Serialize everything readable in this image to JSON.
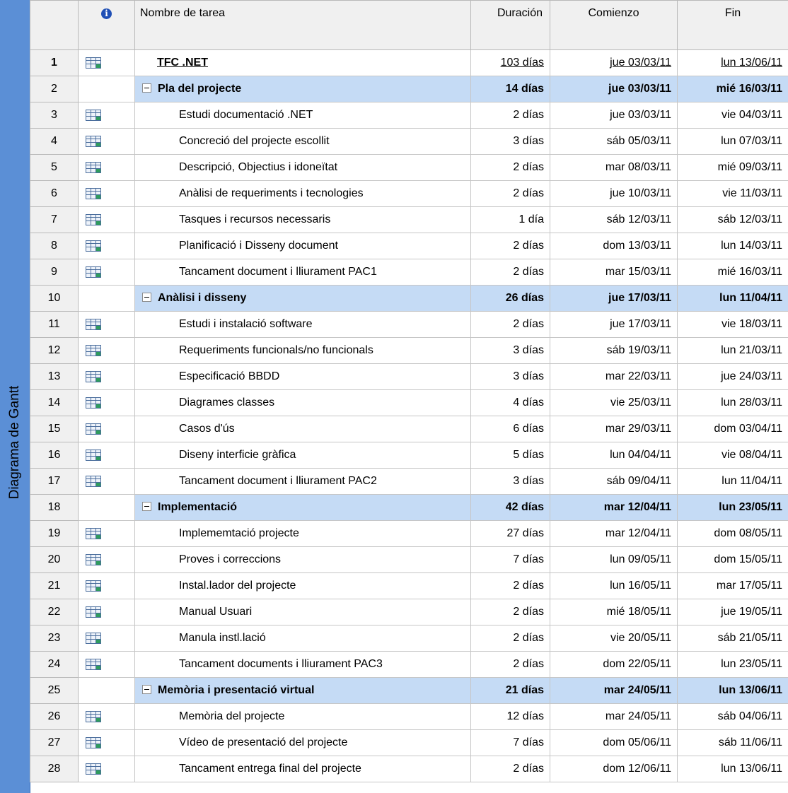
{
  "sidebar": {
    "label": "Diagrama de Gantt"
  },
  "header": {
    "indicator_icon": "info-icon",
    "name": "Nombre de tarea",
    "duration": "Duración",
    "start": "Comienzo",
    "finish": "Fin"
  },
  "tasks": [
    {
      "id": "1",
      "name": "TFC .NET",
      "duration": "103 días",
      "start": "jue 03/03/11",
      "finish": "lun 13/06/11",
      "type": "project",
      "icon": "task-icon"
    },
    {
      "id": "2",
      "name": "Pla del projecte",
      "duration": "14 días",
      "start": "jue 03/03/11",
      "finish": "mié 16/03/11",
      "type": "summary",
      "icon": ""
    },
    {
      "id": "3",
      "name": "Estudi documentació .NET",
      "duration": "2 días",
      "start": "jue 03/03/11",
      "finish": "vie 04/03/11",
      "type": "task",
      "icon": "task-icon"
    },
    {
      "id": "4",
      "name": "Concreció del projecte escollit",
      "duration": "3 días",
      "start": "sáb 05/03/11",
      "finish": "lun 07/03/11",
      "type": "task",
      "icon": "task-icon"
    },
    {
      "id": "5",
      "name": "Descripció, Objectius i idoneïtat",
      "duration": "2 días",
      "start": "mar 08/03/11",
      "finish": "mié 09/03/11",
      "type": "task",
      "icon": "task-icon"
    },
    {
      "id": "6",
      "name": "Anàlisi de requeriments i tecnologies",
      "duration": "2 días",
      "start": "jue 10/03/11",
      "finish": "vie 11/03/11",
      "type": "task",
      "icon": "task-icon"
    },
    {
      "id": "7",
      "name": "Tasques i recursos necessaris",
      "duration": "1 día",
      "start": "sáb 12/03/11",
      "finish": "sáb 12/03/11",
      "type": "task",
      "icon": "task-icon"
    },
    {
      "id": "8",
      "name": "Planificació i Disseny document",
      "duration": "2 días",
      "start": "dom 13/03/11",
      "finish": "lun 14/03/11",
      "type": "task",
      "icon": "task-icon"
    },
    {
      "id": "9",
      "name": "Tancament document i lliurament PAC1",
      "duration": "2 días",
      "start": "mar 15/03/11",
      "finish": "mié 16/03/11",
      "type": "task",
      "icon": "task-icon"
    },
    {
      "id": "10",
      "name": "Anàlisi i disseny",
      "duration": "26 días",
      "start": "jue 17/03/11",
      "finish": "lun 11/04/11",
      "type": "summary",
      "icon": ""
    },
    {
      "id": "11",
      "name": "Estudi i instalació software",
      "duration": "2 días",
      "start": "jue 17/03/11",
      "finish": "vie 18/03/11",
      "type": "task",
      "icon": "task-icon"
    },
    {
      "id": "12",
      "name": "Requeriments funcionals/no funcionals",
      "duration": "3 días",
      "start": "sáb 19/03/11",
      "finish": "lun 21/03/11",
      "type": "task",
      "icon": "task-icon"
    },
    {
      "id": "13",
      "name": "Especificació BBDD",
      "duration": "3 días",
      "start": "mar 22/03/11",
      "finish": "jue 24/03/11",
      "type": "task",
      "icon": "task-icon"
    },
    {
      "id": "14",
      "name": "Diagrames classes",
      "duration": "4 días",
      "start": "vie 25/03/11",
      "finish": "lun 28/03/11",
      "type": "task",
      "icon": "task-icon"
    },
    {
      "id": "15",
      "name": "Casos d'ús",
      "duration": "6 días",
      "start": "mar 29/03/11",
      "finish": "dom 03/04/11",
      "type": "task",
      "icon": "task-icon"
    },
    {
      "id": "16",
      "name": "Diseny interficie gràfica",
      "duration": "5 días",
      "start": "lun 04/04/11",
      "finish": "vie 08/04/11",
      "type": "task",
      "icon": "task-icon"
    },
    {
      "id": "17",
      "name": "Tancament document i lliurament PAC2",
      "duration": "3 días",
      "start": "sáb 09/04/11",
      "finish": "lun 11/04/11",
      "type": "task",
      "icon": "task-icon"
    },
    {
      "id": "18",
      "name": "Implementació",
      "duration": "42 días",
      "start": "mar 12/04/11",
      "finish": "lun 23/05/11",
      "type": "summary",
      "icon": ""
    },
    {
      "id": "19",
      "name": "Implememtació projecte",
      "duration": "27 días",
      "start": "mar 12/04/11",
      "finish": "dom 08/05/11",
      "type": "task",
      "icon": "task-icon"
    },
    {
      "id": "20",
      "name": "Proves i correccions",
      "duration": "7 días",
      "start": "lun 09/05/11",
      "finish": "dom 15/05/11",
      "type": "task",
      "icon": "task-icon"
    },
    {
      "id": "21",
      "name": "Instal.lador del projecte",
      "duration": "2 días",
      "start": "lun 16/05/11",
      "finish": "mar 17/05/11",
      "type": "task",
      "icon": "task-icon"
    },
    {
      "id": "22",
      "name": "Manual Usuari",
      "duration": "2 días",
      "start": "mié 18/05/11",
      "finish": "jue 19/05/11",
      "type": "task",
      "icon": "task-icon"
    },
    {
      "id": "23",
      "name": "Manula instl.lació",
      "duration": "2 días",
      "start": "vie 20/05/11",
      "finish": "sáb 21/05/11",
      "type": "task",
      "icon": "task-icon"
    },
    {
      "id": "24",
      "name": "Tancament documents i lliurament PAC3",
      "duration": "2 días",
      "start": "dom 22/05/11",
      "finish": "lun 23/05/11",
      "type": "task",
      "icon": "task-icon"
    },
    {
      "id": "25",
      "name": "Memòria i presentació virtual",
      "duration": "21 días",
      "start": "mar 24/05/11",
      "finish": "lun 13/06/11",
      "type": "summary",
      "icon": ""
    },
    {
      "id": "26",
      "name": "Memòria del projecte",
      "duration": "12 días",
      "start": "mar 24/05/11",
      "finish": "sáb 04/06/11",
      "type": "task",
      "icon": "task-icon"
    },
    {
      "id": "27",
      "name": "Vídeo de presentació del projecte",
      "duration": "7 días",
      "start": "dom 05/06/11",
      "finish": "sáb 11/06/11",
      "type": "task",
      "icon": "task-icon"
    },
    {
      "id": "28",
      "name": "Tancament entrega final del projecte",
      "duration": "2 días",
      "start": "dom 12/06/11",
      "finish": "lun 13/06/11",
      "type": "task",
      "icon": "task-icon"
    }
  ]
}
